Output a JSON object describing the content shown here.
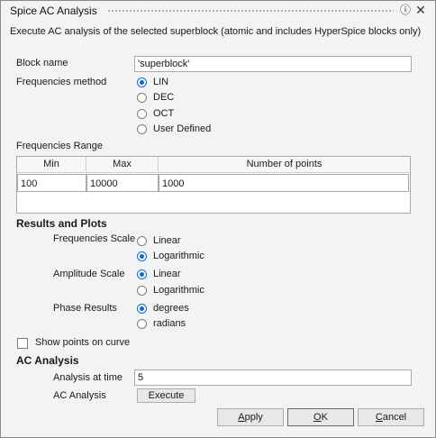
{
  "window": {
    "title": "Spice AC Analysis",
    "help_icon": "help-circle-icon",
    "close_icon": "close-icon"
  },
  "description": "Execute AC analysis of the selected superblock (atomic and includes HyperSpice blocks only)",
  "block_name": {
    "label": "Block name",
    "value": "'superblock'"
  },
  "frequencies_method": {
    "label": "Frequencies method",
    "options": [
      "LIN",
      "DEC",
      "OCT",
      "User Defined"
    ],
    "selected": "LIN"
  },
  "frequencies_range": {
    "label": "Frequencies Range",
    "columns": [
      "Min",
      "Max",
      "Number of points"
    ],
    "rows": [
      [
        "100",
        "10000",
        "1000"
      ]
    ]
  },
  "results": {
    "heading": "Results and Plots",
    "frequencies_scale": {
      "label": "Frequencies Scale",
      "options": [
        "Linear",
        "Logarithmic"
      ],
      "selected": "Logarithmic"
    },
    "amplitude_scale": {
      "label": "Amplitude Scale",
      "options": [
        "Linear",
        "Logarithmic"
      ],
      "selected": "Linear"
    },
    "phase_results": {
      "label": "Phase Results",
      "options": [
        "degrees",
        "radians"
      ],
      "selected": "degrees"
    },
    "show_points": {
      "label": "Show points on curve",
      "checked": false
    }
  },
  "ac_analysis": {
    "heading": "AC Analysis",
    "time_label": "Analysis at time",
    "time_value": "5",
    "run_label": "AC Analysis",
    "execute_label": "Execute"
  },
  "buttons": {
    "apply_prefix": "",
    "apply_u": "A",
    "apply_rest": "pply",
    "ok_u": "O",
    "ok_rest": "K",
    "cancel_u": "C",
    "cancel_rest": "ancel"
  },
  "colors": {
    "accent": "#0a6cd6",
    "background": "#f3f3f3"
  }
}
